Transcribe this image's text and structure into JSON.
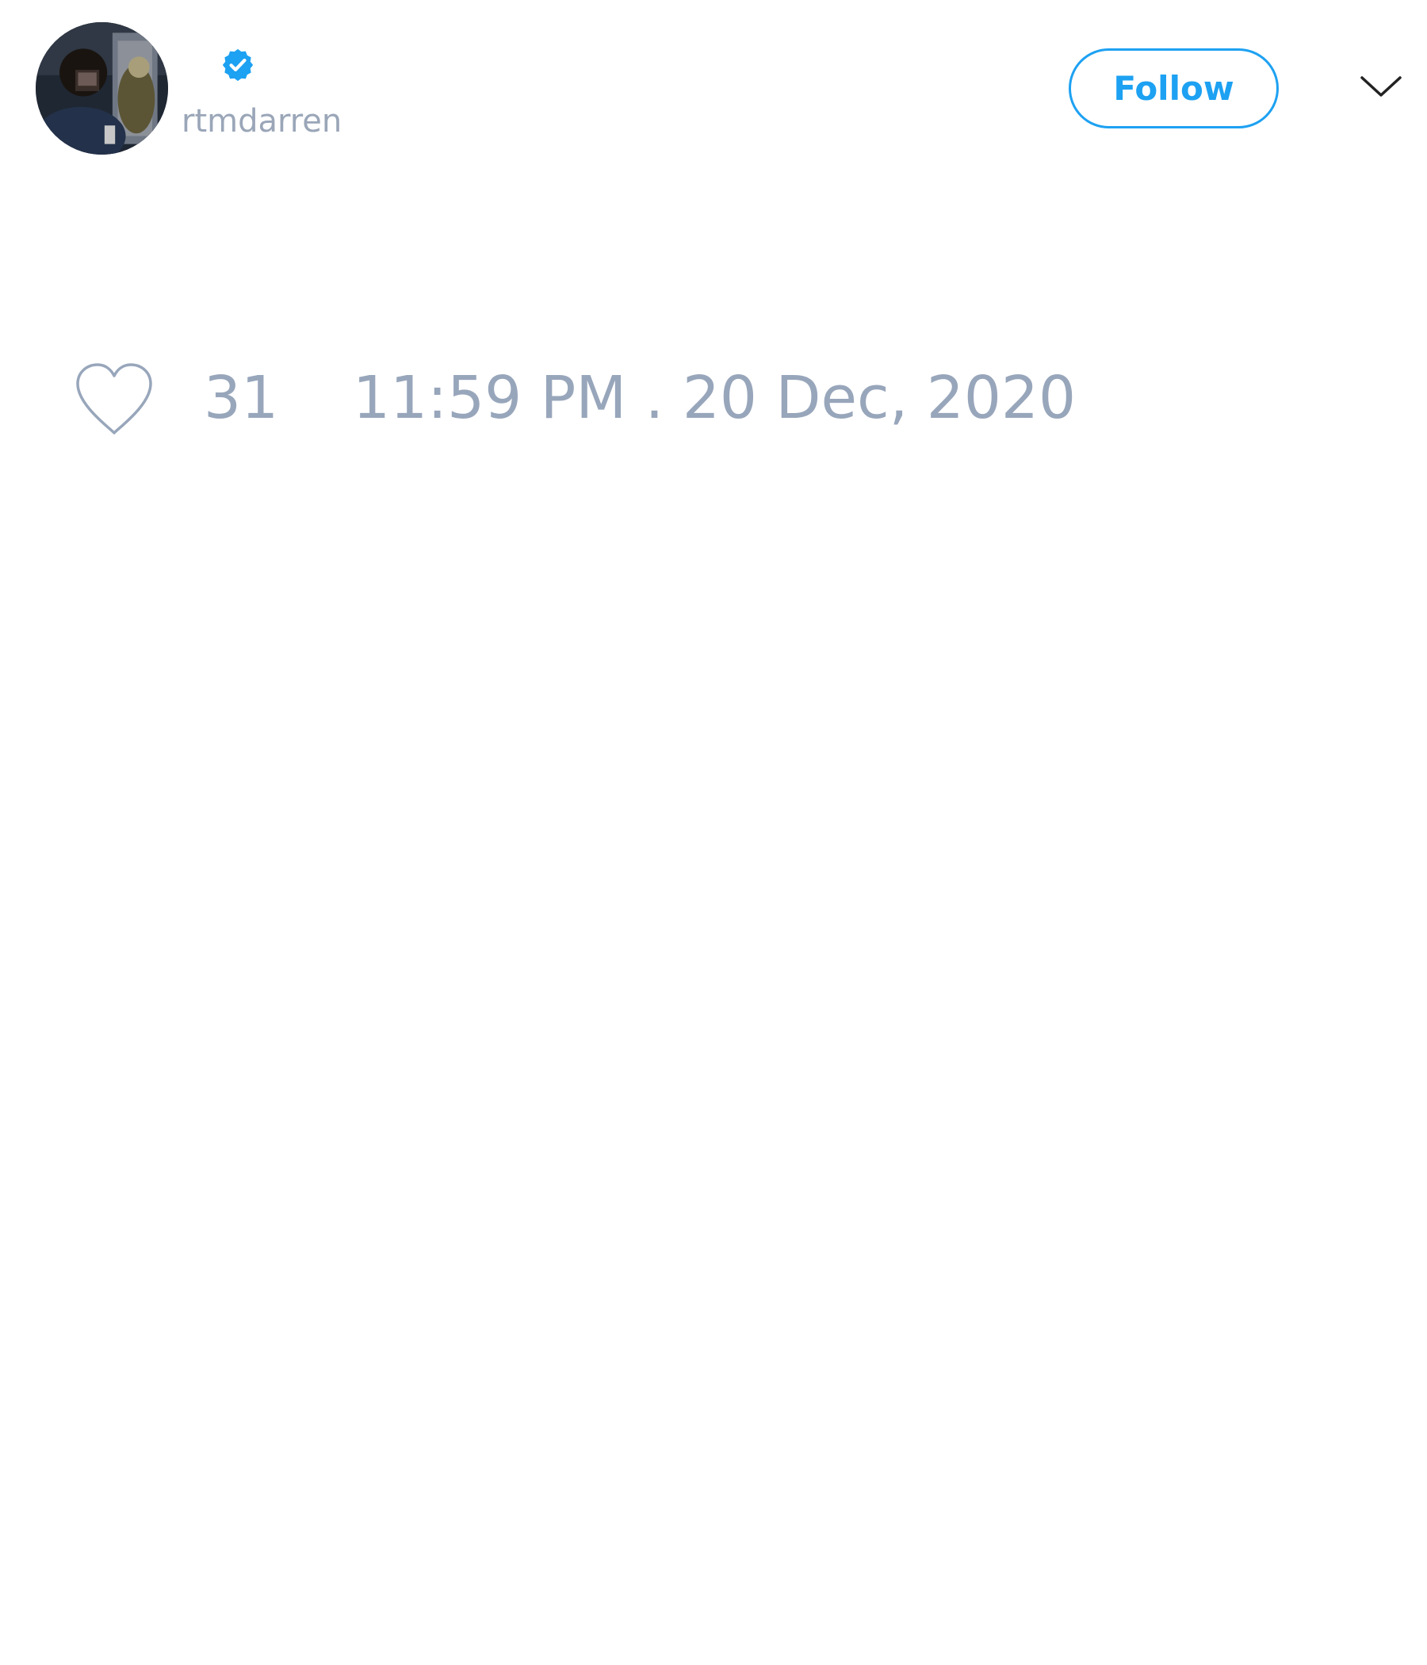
{
  "colors": {
    "accent": "#1da1f2",
    "muted_text": "#98a6bb",
    "background": "#ffffff"
  },
  "author": {
    "handle": "rtmdarren",
    "verified_badge_icon": "verified-badge-icon",
    "avatar_icon": "profile-photo"
  },
  "header": {
    "follow_label": "Follow",
    "more_icon": "chevron-down-icon"
  },
  "meta": {
    "like_icon": "heart-outline-icon",
    "like_count": "31",
    "timestamp": "11:59 PM . 20 Dec, 2020"
  }
}
